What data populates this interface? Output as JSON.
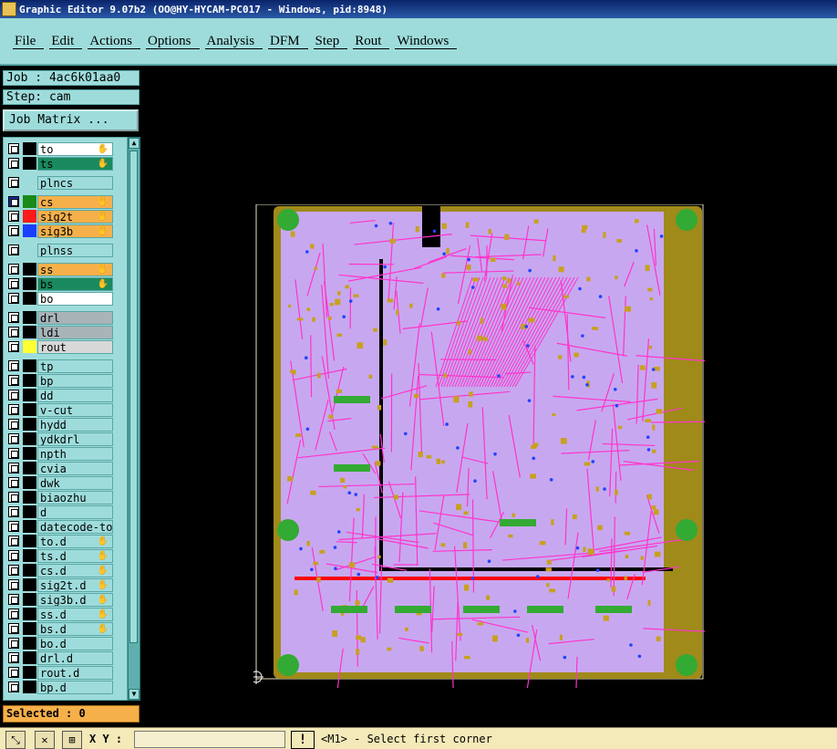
{
  "window": {
    "title": "Graphic Editor 9.07b2 (OO@HY-HYCAM-PC017 - Windows, pid:8948)"
  },
  "menu": [
    "File",
    "Edit",
    "Actions",
    "Options",
    "Analysis",
    "DFM",
    "Step",
    "Rout",
    "Windows"
  ],
  "job": {
    "job_label": "Job : 4ac6k01aa0",
    "step_label": "Step: cam",
    "matrix_label": "Job Matrix ..."
  },
  "layers": [
    {
      "name": "to",
      "bg": "#ffffff",
      "swatch": "#000000",
      "hand": true,
      "gap_before": 0
    },
    {
      "name": "ts",
      "bg": "#1a8a5e",
      "swatch": "#000000",
      "hand": true,
      "gap_before": 0
    },
    {
      "name": "plncs",
      "bg": "#9edcdb",
      "swatch": "",
      "hand": false,
      "gap_before": 5
    },
    {
      "name": "cs",
      "bg": "#f6b04a",
      "swatch": "#1a8a1a",
      "hand": true,
      "gap_before": 5,
      "active": true
    },
    {
      "name": "sig2t",
      "bg": "#f6b04a",
      "swatch": "#ff1a1a",
      "hand": true,
      "gap_before": 0
    },
    {
      "name": "sig3b",
      "bg": "#f6b04a",
      "swatch": "#1a40ff",
      "hand": true,
      "gap_before": 0
    },
    {
      "name": "plnss",
      "bg": "#9edcdb",
      "swatch": "",
      "hand": false,
      "gap_before": 5
    },
    {
      "name": "ss",
      "bg": "#f6b04a",
      "swatch": "#000000",
      "hand": true,
      "gap_before": 5
    },
    {
      "name": "bs",
      "bg": "#1a8a5e",
      "swatch": "#000000",
      "hand": true,
      "gap_before": 0
    },
    {
      "name": "bo",
      "bg": "#ffffff",
      "swatch": "#000000",
      "hand": false,
      "gap_before": 0
    },
    {
      "name": "drl",
      "bg": "#a8b4b8",
      "swatch": "#000000",
      "hand": false,
      "gap_before": 5
    },
    {
      "name": "ldi",
      "bg": "#a8b4b8",
      "swatch": "#000000",
      "hand": false,
      "gap_before": 0
    },
    {
      "name": "rout",
      "bg": "#d8d8d8",
      "swatch": "#ffff33",
      "hand": false,
      "gap_before": 0
    },
    {
      "name": "tp",
      "bg": "#9edcdb",
      "swatch": "#000000",
      "hand": false,
      "gap_before": 5
    },
    {
      "name": "bp",
      "bg": "#9edcdb",
      "swatch": "#000000",
      "hand": false,
      "gap_before": 0
    },
    {
      "name": "dd",
      "bg": "#9edcdb",
      "swatch": "#000000",
      "hand": false,
      "gap_before": 0
    },
    {
      "name": "v-cut",
      "bg": "#9edcdb",
      "swatch": "#000000",
      "hand": false,
      "gap_before": 0
    },
    {
      "name": "hydd",
      "bg": "#9edcdb",
      "swatch": "#000000",
      "hand": false,
      "gap_before": 0
    },
    {
      "name": "ydkdrl",
      "bg": "#9edcdb",
      "swatch": "#000000",
      "hand": false,
      "gap_before": 0
    },
    {
      "name": "npth",
      "bg": "#9edcdb",
      "swatch": "#000000",
      "hand": false,
      "gap_before": 0
    },
    {
      "name": "cvia",
      "bg": "#9edcdb",
      "swatch": "#000000",
      "hand": false,
      "gap_before": 0
    },
    {
      "name": "dwk",
      "bg": "#9edcdb",
      "swatch": "#000000",
      "hand": false,
      "gap_before": 0
    },
    {
      "name": "biaozhu",
      "bg": "#9edcdb",
      "swatch": "#000000",
      "hand": false,
      "gap_before": 0
    },
    {
      "name": "d",
      "bg": "#9edcdb",
      "swatch": "#000000",
      "hand": false,
      "gap_before": 0
    },
    {
      "name": "datecode-to",
      "bg": "#9edcdb",
      "swatch": "#000000",
      "hand": false,
      "gap_before": 0
    },
    {
      "name": "to.d",
      "bg": "#9edcdb",
      "swatch": "#000000",
      "hand": true,
      "gap_before": 0
    },
    {
      "name": "ts.d",
      "bg": "#9edcdb",
      "swatch": "#000000",
      "hand": true,
      "gap_before": 0
    },
    {
      "name": "cs.d",
      "bg": "#9edcdb",
      "swatch": "#000000",
      "hand": true,
      "gap_before": 0
    },
    {
      "name": "sig2t.d",
      "bg": "#9edcdb",
      "swatch": "#000000",
      "hand": true,
      "gap_before": 0
    },
    {
      "name": "sig3b.d",
      "bg": "#9edcdb",
      "swatch": "#000000",
      "hand": true,
      "gap_before": 0
    },
    {
      "name": "ss.d",
      "bg": "#9edcdb",
      "swatch": "#000000",
      "hand": true,
      "gap_before": 0
    },
    {
      "name": "bs.d",
      "bg": "#9edcdb",
      "swatch": "#000000",
      "hand": true,
      "gap_before": 0
    },
    {
      "name": "bo.d",
      "bg": "#9edcdb",
      "swatch": "#000000",
      "hand": false,
      "gap_before": 0
    },
    {
      "name": "drl.d",
      "bg": "#9edcdb",
      "swatch": "#000000",
      "hand": false,
      "gap_before": 0
    },
    {
      "name": "rout.d",
      "bg": "#9edcdb",
      "swatch": "#000000",
      "hand": false,
      "gap_before": 0
    },
    {
      "name": "bp.d",
      "bg": "#9edcdb",
      "swatch": "#000000",
      "hand": false,
      "gap_before": 0
    }
  ],
  "selected": {
    "label": "Selected : 0"
  },
  "status": {
    "xy_label": "X Y :",
    "xy_value": "",
    "warn_label": "!",
    "prompt": "<M1> - Select first corner"
  },
  "colors": {
    "board_fill": "#c7a8f0",
    "board_edge": "#a08a1a",
    "trace": "#ff33cc",
    "pad": "#c8a020",
    "fiducial": "#33aa33"
  }
}
